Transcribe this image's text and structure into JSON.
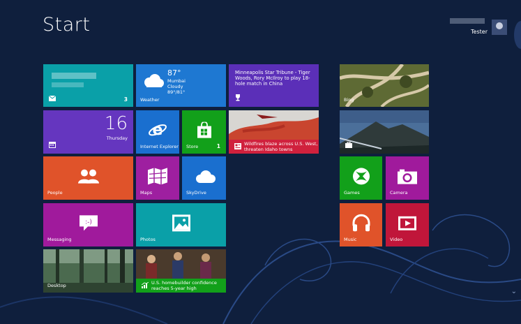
{
  "screen": {
    "title": "Start"
  },
  "user": {
    "name": "Tester"
  },
  "tiles": {
    "mail": {
      "badge": "3",
      "icon": "mail-icon"
    },
    "weather": {
      "label": "Weather",
      "temp": "87°",
      "city": "Mumbai",
      "condition": "Cloudy",
      "range": "89°/81°"
    },
    "news1": {
      "headline": "Minneapolis Star Tribune - Tiger Woods, Rory McIlroy to play 18-hole match in China"
    },
    "calendar": {
      "date": "16",
      "day": "Thursday"
    },
    "ie": {
      "label": "Internet Explorer"
    },
    "store": {
      "label": "Store",
      "badge": "1"
    },
    "fire": {
      "headline": "Wildfires blaze across U.S. West, threaten Idaho towns"
    },
    "people": {
      "label": "People"
    },
    "maps": {
      "label": "Maps"
    },
    "skydrive": {
      "label": "SkyDrive"
    },
    "messaging": {
      "label": "Messaging"
    },
    "photos": {
      "label": "Photos"
    },
    "desktop": {
      "label": "Desktop"
    },
    "finance": {
      "headline": "U.S. homebuilder confidence reaches 5-year high"
    },
    "bing": {
      "label": "Bing"
    },
    "games": {
      "label": "Games"
    },
    "camera": {
      "label": "Camera"
    },
    "music": {
      "label": "Music"
    },
    "video": {
      "label": "Video"
    }
  },
  "colors": {
    "background": "#0f1f3d",
    "teal": "#0aa0a8",
    "blue": "#1a6fcf",
    "purple": "#6536bf",
    "green": "#12a01a",
    "orange": "#e0532a",
    "magenta": "#a01a9c",
    "red": "#d0213d"
  }
}
